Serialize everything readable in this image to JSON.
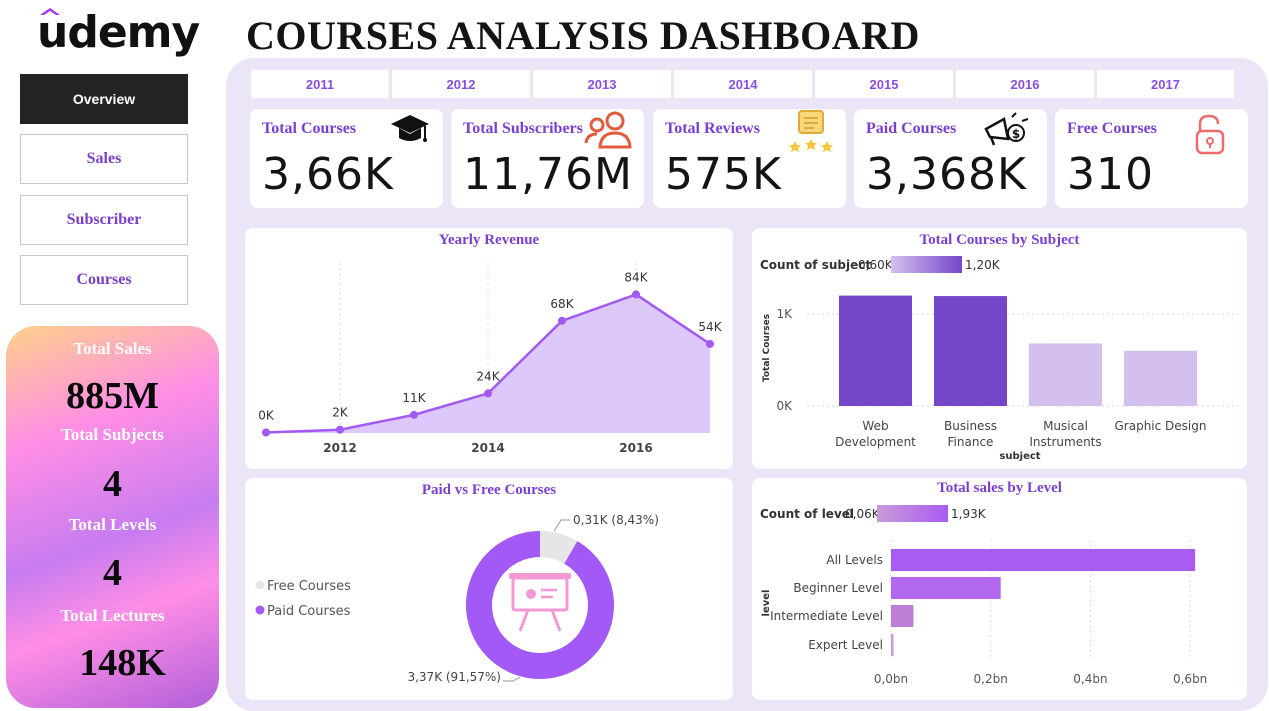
{
  "brand": {
    "logo_text": "udemy"
  },
  "header": {
    "title": "COURSES ANALYSIS DASHBOARD"
  },
  "nav": [
    {
      "label": "Overview",
      "active": true
    },
    {
      "label": "Sales",
      "active": false
    },
    {
      "label": "Subscriber",
      "active": false
    },
    {
      "label": "Courses",
      "active": false
    }
  ],
  "side_stats": {
    "total_sales_label": "Total Sales",
    "total_sales_value": "885M",
    "total_subjects_label": "Total Subjects",
    "total_subjects_value": "4",
    "total_levels_label": "Total Levels",
    "total_levels_value": "4",
    "total_lectures_label": "Total Lectures",
    "total_lectures_value": "148K"
  },
  "years": [
    "2011",
    "2012",
    "2013",
    "2014",
    "2015",
    "2016",
    "2017"
  ],
  "kpis": [
    {
      "label": "Total Courses",
      "value": "3,66K",
      "icon": "graduation-cap-icon"
    },
    {
      "label": "Total Subscribers",
      "value": "11,76M",
      "icon": "users-icon"
    },
    {
      "label": "Total Reviews",
      "value": "575K",
      "icon": "review-stars-icon"
    },
    {
      "label": "Paid Courses",
      "value": "3,368K",
      "icon": "megaphone-money-icon"
    },
    {
      "label": "Free Courses",
      "value": "310",
      "icon": "unlock-icon"
    }
  ],
  "colors": {
    "accent": "#7b3fd0",
    "purple_dark": "#7447c8",
    "purple_light": "#d3c0ef",
    "area_fill": "#dcc8fb",
    "line": "#a35af0",
    "donut_paid": "#a259f5",
    "donut_free": "#e6e6e6",
    "bar_level": "#a95cf2"
  },
  "charts": {
    "yearly_revenue": {
      "title": "Yearly Revenue",
      "chart_data": {
        "type": "area",
        "x": [
          2011,
          2012,
          2013,
          2014,
          2015,
          2016,
          2017
        ],
        "values": [
          0.3,
          2,
          11,
          24,
          68,
          84,
          54
        ],
        "data_labels": [
          "0K",
          "2K",
          "11K",
          "24K",
          "68K",
          "84K",
          "54K"
        ],
        "x_ticks": [
          "2012",
          "2014",
          "2016"
        ],
        "y_range": [
          0,
          100
        ],
        "grid": true
      }
    },
    "courses_by_subject": {
      "title": "Total Courses by Subject",
      "legend_label": "Count of subject",
      "legend_min": "0,60K",
      "legend_max": "1,20K",
      "ylabel": "Total Courses",
      "xlabel": "subject",
      "y_ticks": [
        "0K",
        "1K"
      ],
      "chart_data": {
        "type": "bar",
        "categories": [
          "Web Development",
          "Business Finance",
          "Musical Instruments",
          "Graphic Design"
        ],
        "category_lines": [
          [
            "Web",
            "Development"
          ],
          [
            "Business",
            "Finance"
          ],
          [
            "Musical",
            "Instruments"
          ],
          [
            "Graphic Design"
          ]
        ],
        "values": [
          1200,
          1195,
          680,
          600
        ],
        "y_range": [
          0,
          1500
        ]
      }
    },
    "paid_vs_free": {
      "title": "Paid vs Free Courses",
      "legend": [
        "Free Courses",
        "Paid Courses"
      ],
      "chart_data": {
        "type": "pie",
        "donut": true,
        "categories": [
          "Free Courses",
          "Paid Courses"
        ],
        "values": [
          0.31,
          3.37
        ],
        "percentages": [
          8.43,
          91.57
        ],
        "data_labels": [
          "0,31K (8,43%)",
          "3,37K (91,57%)"
        ]
      }
    },
    "sales_by_level": {
      "title": "Total sales by Level",
      "legend_label": "Count of level",
      "legend_min": "0,06K",
      "legend_max": "1,93K",
      "ylabel": "level",
      "x_ticks": [
        "0,0bn",
        "0,2bn",
        "0,4bn",
        "0,6bn"
      ],
      "chart_data": {
        "type": "bar",
        "orientation": "horizontal",
        "categories": [
          "All Levels",
          "Beginner Level",
          "Intermediate Level",
          "Expert Level"
        ],
        "values": [
          0.61,
          0.22,
          0.045,
          0.005
        ],
        "x_range": [
          0,
          0.7
        ]
      }
    }
  }
}
